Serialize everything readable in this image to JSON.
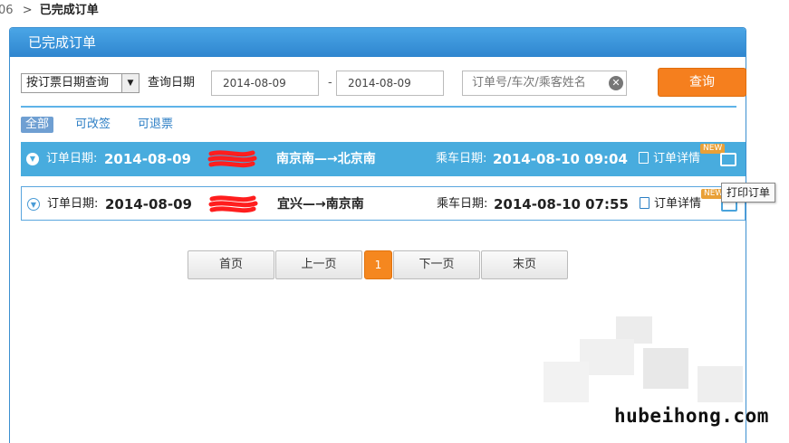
{
  "breadcrumb": {
    "prefix": "06",
    "separator": ">",
    "current": "已完成订单"
  },
  "panel": {
    "title": "已完成订单"
  },
  "search": {
    "mode_selected": "按订票日期查询",
    "date_label": "查询日期",
    "start_date": "2014-08-09",
    "date_separator": "-",
    "end_date": "2014-08-09",
    "keyword_placeholder": "订单号/车次/乘客姓名",
    "query_label": "查询"
  },
  "filters": [
    {
      "label": "全部",
      "active": true
    },
    {
      "label": "可改签",
      "active": false
    },
    {
      "label": "可退票",
      "active": false
    }
  ],
  "orders": [
    {
      "order_date_label": "订单日期:",
      "order_date": "2014-08-09",
      "route": "南京南—→北京南",
      "travel_date_label": "乘车日期:",
      "travel_datetime": "2014-08-10 09:04",
      "detail_label": "订单详情",
      "new_badge": "NEW",
      "selected": true
    },
    {
      "order_date_label": "订单日期:",
      "order_date": "2014-08-09",
      "route": "宜兴—→南京南",
      "travel_date_label": "乘车日期:",
      "travel_datetime": "2014-08-10 07:55",
      "detail_label": "订单详情",
      "new_badge": "NEW",
      "selected": false
    }
  ],
  "tooltip": {
    "print_order": "打印订单"
  },
  "pagination": {
    "first": "首页",
    "prev": "上一页",
    "current_page": "1",
    "next": "下一页",
    "last": "末页"
  },
  "watermark": "hubeihong.com",
  "colors": {
    "header_blue": "#3b8fd0",
    "selected_row": "#48acde",
    "query_orange": "#f57f1e",
    "link_blue": "#2e7fc5",
    "redaction_red": "#ff1e1e"
  }
}
